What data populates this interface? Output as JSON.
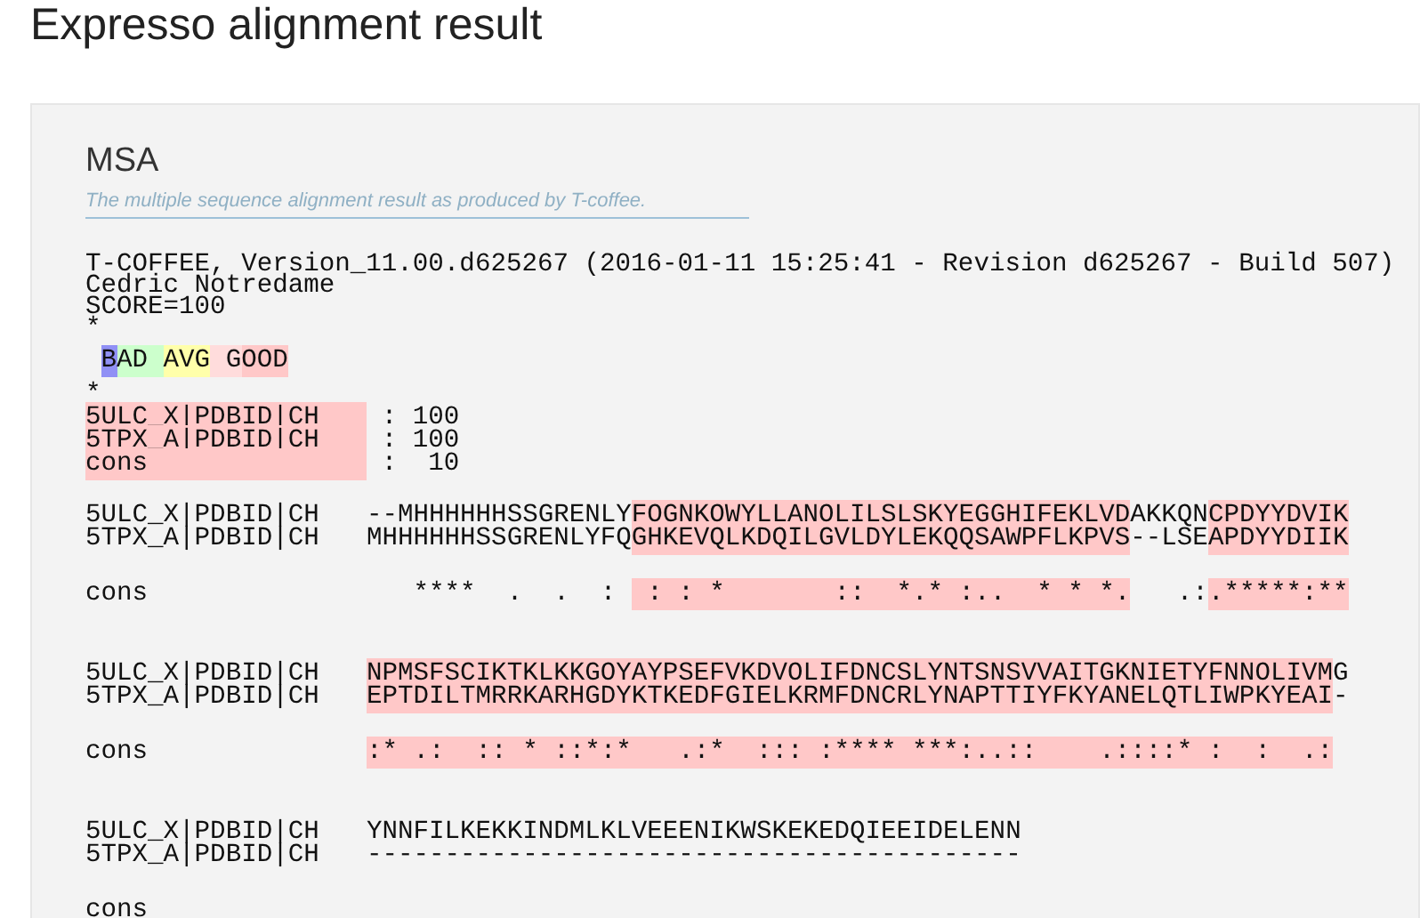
{
  "page_title": "Expresso alignment result",
  "panel": {
    "title": "MSA",
    "subtitle": "The multiple sequence alignment result as produced by T-coffee.",
    "header": [
      "T-COFFEE, Version_11.00.d625267 (2016-01-11 15:25:41 - Revision d625267 - Build 507)",
      "Cedric Notredame",
      "SCORE=100",
      "*"
    ],
    "legend": [
      {
        "text": "B",
        "color": "#9090f5"
      },
      {
        "text": "AD ",
        "color": "#ccffcc"
      },
      {
        "text": "AVG",
        "color": "#ffffaa"
      },
      {
        "text": " G",
        "color": "#ffdcdc"
      },
      {
        "text": "OOD",
        "color": "#ffc8c8"
      }
    ],
    "legend_end": "*",
    "scores": [
      {
        "name": "5ULC_X|PDBID|CH   ",
        "color": "#ffc8c8",
        "value": ": 100"
      },
      {
        "name": "5TPX_A|PDBID|CH   ",
        "color": "#ffc8c8",
        "value": ": 100"
      },
      {
        "name": "cons              ",
        "color": "#ffc8c8",
        "value": ":  10"
      }
    ],
    "blocks": [
      {
        "rows": [
          {
            "name": "5ULC_X|PDBID|CH",
            "segments": [
              {
                "text": "--MHHHHHHSSGRENLY"
              },
              {
                "text": "FOGNKOWYLLANOLILSLSKYEGGHIFEKLVD",
                "color": "#ffc8c8"
              },
              {
                "text": "AKKQN"
              },
              {
                "text": "CPDYYDVIK",
                "color": "#ffc8c8"
              }
            ]
          },
          {
            "name": "5TPX_A|PDBID|CH",
            "segments": [
              {
                "text": "MHHHHHHSSGRENLYFQ"
              },
              {
                "text": "GHKEVQLKDQILGVLDYLEKQQSAWPFLKPVS",
                "color": "#ffc8c8"
              },
              {
                "text": "--LSE"
              },
              {
                "text": "APDYYDIIK",
                "color": "#ffc8c8"
              }
            ]
          }
        ],
        "consensus": {
          "name": "cons",
          "segments": [
            {
              "text": "   ****  .  .  : "
            },
            {
              "text": " : : *       ::  *.* :..  * * *.",
              "color": "#ffc8c8"
            },
            {
              "text": "   .:"
            },
            {
              "text": ".*****:**",
              "color": "#ffc8c8"
            }
          ]
        }
      },
      {
        "rows": [
          {
            "name": "5ULC_X|PDBID|CH",
            "segments": [
              {
                "text": "NPMSFSCIKTKLKKGOYAYPSEFVKDVOLIFDNCSLYNTSNSVVAITGKNIETYFNNOLIVM",
                "color": "#ffc8c8"
              },
              {
                "text": "G"
              }
            ]
          },
          {
            "name": "5TPX_A|PDBID|CH",
            "segments": [
              {
                "text": "EPTDILTMRRKARHGDYKTKEDFGIELKRMFDNCRLYNAPTTIYFKYANELQTLIWPKYEAI",
                "color": "#ffc8c8"
              },
              {
                "text": "-"
              }
            ]
          }
        ],
        "consensus": {
          "name": "cons",
          "segments": [
            {
              "text": ":* .:  :: * ::*:*   .:*  ::: :**** ***:..::    .::::* :  :  .:",
              "color": "#ffc8c8"
            }
          ]
        }
      },
      {
        "rows": [
          {
            "name": "5ULC_X|PDBID|CH",
            "segments": [
              {
                "text": "YNNFILKEKKINDMLKLVEEENIKWSKEKEDQIEEIDELENN"
              }
            ]
          },
          {
            "name": "5TPX_A|PDBID|CH",
            "segments": [
              {
                "text": "------------------------------------------"
              }
            ]
          }
        ],
        "consensus": {
          "name": "cons"
        }
      }
    ]
  }
}
